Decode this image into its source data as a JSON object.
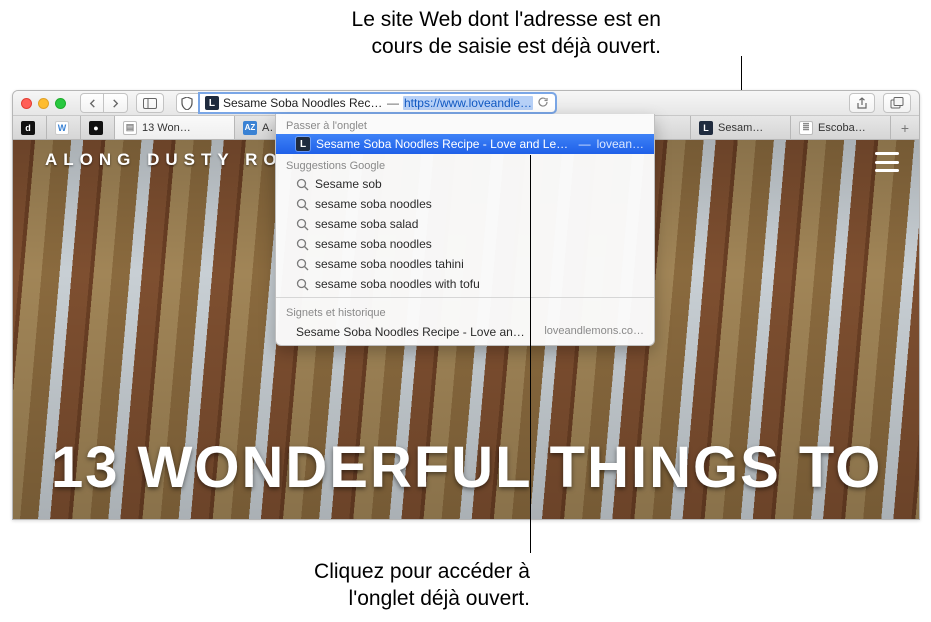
{
  "callouts": {
    "top_line1": "Le site Web dont l'adresse est en",
    "top_line2": "cours de saisie est déjà ouvert.",
    "bottom_line1": "Cliquez pour accéder à",
    "bottom_line2": "l'onglet déjà ouvert."
  },
  "toolbar": {
    "address_typed": "Sesame Soba Noodles Reci…",
    "address_url": "https://www.loveandle…"
  },
  "tabs": [
    {
      "favicon": "d",
      "label": ""
    },
    {
      "favicon": "W",
      "label": ""
    },
    {
      "favicon": "m",
      "label": ""
    },
    {
      "favicon": "page",
      "label": "13 Won…"
    },
    {
      "favicon": "AZ",
      "label": "A…"
    },
    {
      "favicon": "L",
      "label": "Sesam…"
    },
    {
      "favicon": "rl",
      "label": "Escoba…"
    }
  ],
  "page": {
    "site_name": "ALONG DUSTY RO",
    "hero": "13 WONDERFUL THINGS TO"
  },
  "dropdown": {
    "switch_header": "Passer à l'onglet",
    "switch_item_title": "Sesame Soba Noodles Recipe - Love and Lemons",
    "switch_item_source": "lovean…",
    "suggestions_header": "Suggestions Google",
    "suggestions": [
      "Sesame sob",
      "sesame soba noodles",
      "sesame soba salad",
      "sesame soba noodles",
      "sesame soba noodles tahini",
      "sesame soba noodles with tofu"
    ],
    "history_header": "Signets et historique",
    "history_title": "Sesame Soba Noodles Recipe - Love an…",
    "history_domain": "loveandlemons.co…"
  }
}
